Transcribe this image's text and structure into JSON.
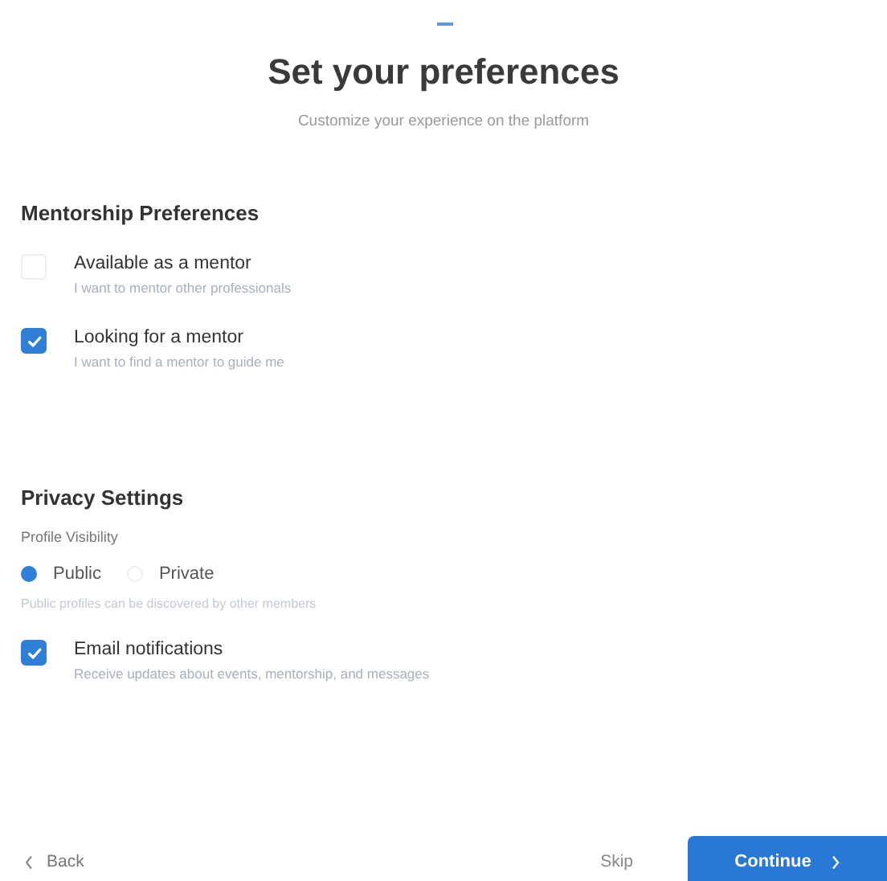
{
  "header": {
    "title": "Set your preferences",
    "subtitle": "Customize your experience on the platform"
  },
  "sections": [
    {
      "heading": "Mentorship Preferences",
      "items": [
        {
          "kind": "checkbox",
          "label": "Available as a mentor",
          "description": "I want to mentor other professionals",
          "checked": false
        },
        {
          "kind": "checkbox",
          "label": "Looking for a mentor",
          "description": "I want to find a mentor to guide me",
          "checked": true
        }
      ]
    },
    {
      "heading": "Privacy Settings",
      "items": [
        {
          "kind": "radio",
          "label": "Profile Visibility",
          "options": [
            {
              "label": "Public",
              "selected": true
            },
            {
              "label": "Private",
              "selected": false
            }
          ],
          "hint": "Public profiles can be discovered by other members"
        },
        {
          "kind": "checkbox",
          "label": "Email notifications",
          "description": "Receive updates about events, mentorship, and messages",
          "checked": true
        }
      ]
    }
  ],
  "footer": {
    "back": "Back",
    "skip": "Skip",
    "continue": "Continue"
  }
}
